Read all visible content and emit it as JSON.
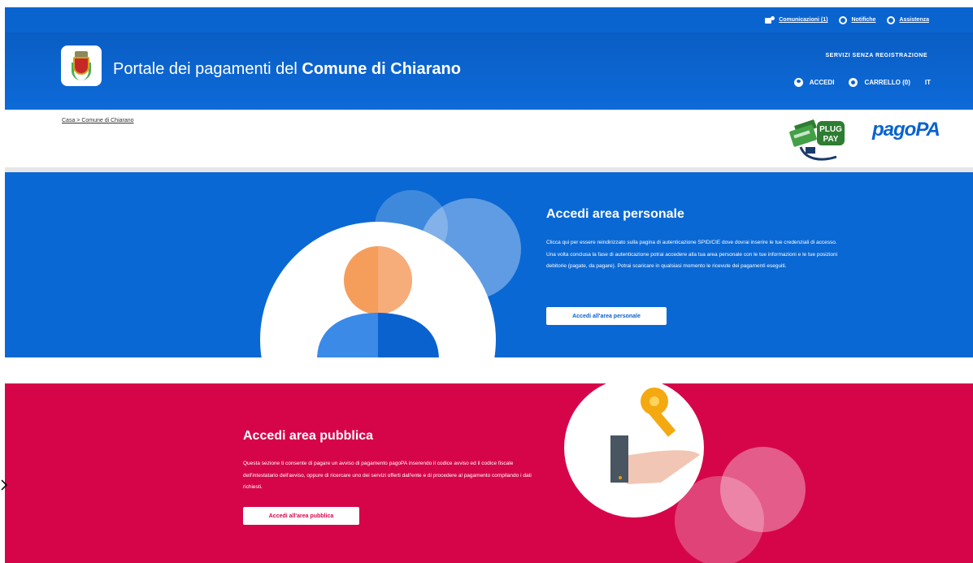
{
  "topbar": {
    "comunicazioni": "Comunicazioni (1)",
    "notifiche": "Notifiche",
    "assistenza": "Assistenza"
  },
  "header": {
    "title_prefix": "Portale dei pagamenti del ",
    "title_entity": "Comune di Chiarano",
    "servizi": "SERVIZI SENZA REGISTRAZIONE",
    "accedi": "ACCEDI",
    "carrello": "CARRELLO (0)",
    "lang": "IT"
  },
  "breadcrumb": "Casa > Comune di Chiarano",
  "logos": {
    "pluspay_line1": "PLUG",
    "pluspay_line2": "PAY",
    "pagopa": "pagoPA"
  },
  "area_personale": {
    "title": "Accedi area personale",
    "description": "Clicca qui per essere reindirizzato sulla pagina di autenticazione SPID/CIE dove dovrai inserire le tue credenziali di accesso. Una volta conclusa la fase di autenticazione potrai accedere alla tua area personale con le tue informazioni e le tue posizioni debitorie (pagate, da pagare). Potrai scaricare in qualsiasi momento le ricevute dei pagamenti eseguiti.",
    "button": "Accedi all'area personale"
  },
  "area_pubblica": {
    "title": "Accedi area pubblica",
    "description": "Questa sezione ti consente di pagare un avviso di pagamento pagoPA inserendo il codice avviso ed il codice fiscale dell'intestatario dell'avviso, oppure di ricercare uno dei servizi offerti dall'ente e di procedere al pagamento compilando i dati richiesti.",
    "button": "Accedi all'area pubblica"
  },
  "colors": {
    "primary_blue": "#0a68d4",
    "public_red": "#d6054a"
  }
}
